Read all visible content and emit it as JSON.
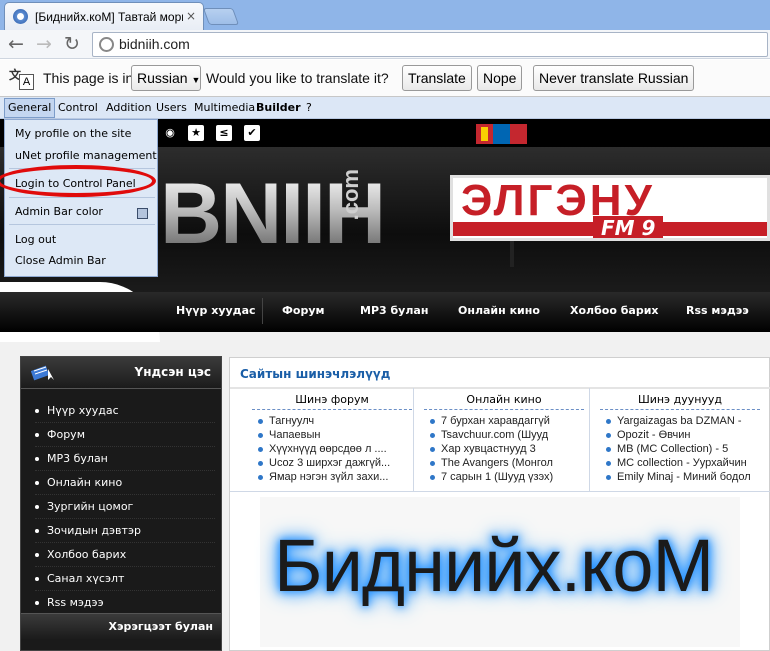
{
  "browser": {
    "tab_title": "[Биднийх.коМ] Тавтай мори",
    "tab_close": "×",
    "url": "bidniih.com",
    "back": "←",
    "forward": "→",
    "reload": "↻"
  },
  "translate_bar": {
    "prefix": "This page is in",
    "language": "Russian",
    "question": "Would you like to translate it?",
    "translate_btn": "Translate",
    "nope_btn": "Nope",
    "never_btn": "Never translate Russian"
  },
  "admin_bar": {
    "items": [
      "General",
      "Control",
      "Addition",
      "Users",
      "Multimedia",
      "Builder",
      "?"
    ]
  },
  "dropdown": {
    "items": [
      "My profile on the site",
      "uNet profile management",
      "Login to Control Panel",
      "Admin Bar color",
      "Log out",
      "Close Admin Bar"
    ]
  },
  "site": {
    "logo": "BNIIH",
    "logo_com": ".com",
    "banner_text": "ЭЛГЭНУ",
    "banner_fm": "FM 9",
    "nav": [
      "Нүүр хуудас",
      "Форум",
      "MP3 булан",
      "Онлайн кино",
      "Холбоо барих",
      "Rss мэдээ"
    ]
  },
  "sidebar": {
    "title": "Үндсэн цэс",
    "items": [
      "Нүүр хуудас",
      "Форум",
      "MP3 булан",
      "Онлайн кино",
      "Зургийн цомог",
      "Зочидын дэвтэр",
      "Холбоо барих",
      "Санал хүсэлт",
      "Rss мэдээ"
    ],
    "sub_title": "Хэрэгцээт булан"
  },
  "updates": {
    "title": "Сайтын шинэчлэлүүд",
    "columns": [
      {
        "header": "Шинэ форум",
        "rows": [
          "Тагнуулч",
          "Чапаевын",
          "Хүүхнүүд өөрсдөө л ....",
          "Ucoz 3 ширхэг дажгүй...",
          "Ямар нэгэн зүйл захи..."
        ]
      },
      {
        "header": "Онлайн кино",
        "rows": [
          "7 бурхан харавдаггүй",
          "Tsavchuur.com (Шууд",
          "Хар хувцастнууд 3",
          "The Avangers (Монгол",
          "7 сарын 1 (Шууд үзэх)"
        ]
      },
      {
        "header": "Шинэ дуунууд",
        "rows": [
          "Yargaizagas ba DZMAN -",
          "Opozit - Өвчин",
          "MB (MC Collection) - 5",
          "MC collection - Уурхайчин",
          "Emily Minaj - Миний бодол"
        ]
      }
    ]
  },
  "big_logo": "Биднийх.коМ"
}
